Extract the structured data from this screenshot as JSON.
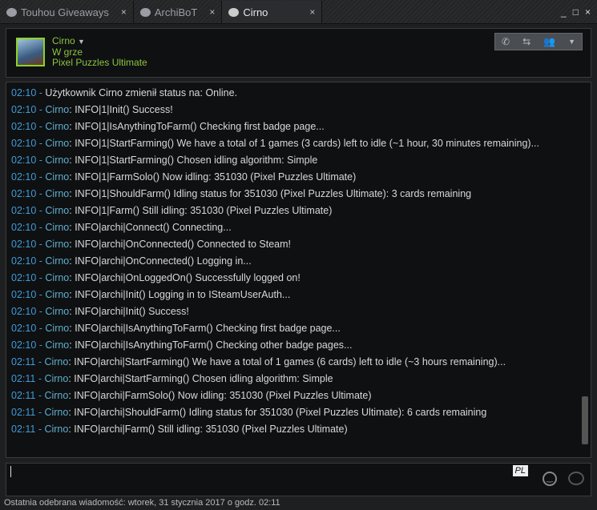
{
  "tabs": [
    {
      "label": "Touhou Giveaways",
      "close": "×"
    },
    {
      "label": "ArchiBoT",
      "close": "×"
    },
    {
      "label": "Cirno",
      "close": "×"
    }
  ],
  "window_controls": {
    "minimize": "_",
    "maximize": "□",
    "close": "×"
  },
  "header": {
    "name": "Cirno",
    "status": "W grze",
    "game": "Pixel Puzzles Ultimate"
  },
  "messages": [
    {
      "time": "02:10",
      "sep": " - ",
      "name": "",
      "text": "Użytkownik Cirno zmienił status na: Online."
    },
    {
      "time": "02:10",
      "sep": " - ",
      "name": "Cirno",
      "text": ": INFO|1|Init() Success!"
    },
    {
      "time": "02:10",
      "sep": " - ",
      "name": "Cirno",
      "text": ": INFO|1|IsAnythingToFarm() Checking first badge page..."
    },
    {
      "time": "02:10",
      "sep": " - ",
      "name": "Cirno",
      "text": ": INFO|1|StartFarming() We have a total of 1 games (3 cards) left to idle (~1 hour, 30 minutes remaining)..."
    },
    {
      "time": "02:10",
      "sep": " - ",
      "name": "Cirno",
      "text": ": INFO|1|StartFarming() Chosen idling algorithm: Simple"
    },
    {
      "time": "02:10",
      "sep": " - ",
      "name": "Cirno",
      "text": ": INFO|1|FarmSolo() Now idling: 351030 (Pixel Puzzles Ultimate)"
    },
    {
      "time": "02:10",
      "sep": " - ",
      "name": "Cirno",
      "text": ": INFO|1|ShouldFarm() Idling status for 351030 (Pixel Puzzles Ultimate): 3 cards remaining"
    },
    {
      "time": "02:10",
      "sep": " - ",
      "name": "Cirno",
      "text": ": INFO|1|Farm() Still idling: 351030 (Pixel Puzzles Ultimate)"
    },
    {
      "time": "02:10",
      "sep": " - ",
      "name": "Cirno",
      "text": ": INFO|archi|Connect() Connecting..."
    },
    {
      "time": "02:10",
      "sep": " - ",
      "name": "Cirno",
      "text": ": INFO|archi|OnConnected() Connected to Steam!"
    },
    {
      "time": "02:10",
      "sep": " - ",
      "name": "Cirno",
      "text": ": INFO|archi|OnConnected() Logging in..."
    },
    {
      "time": "02:10",
      "sep": " - ",
      "name": "Cirno",
      "text": ": INFO|archi|OnLoggedOn() Successfully logged on!"
    },
    {
      "time": "02:10",
      "sep": " - ",
      "name": "Cirno",
      "text": ": INFO|archi|Init() Logging in to ISteamUserAuth..."
    },
    {
      "time": "02:10",
      "sep": " - ",
      "name": "Cirno",
      "text": ": INFO|archi|Init() Success!"
    },
    {
      "time": "02:10",
      "sep": " - ",
      "name": "Cirno",
      "text": ": INFO|archi|IsAnythingToFarm() Checking first badge page..."
    },
    {
      "time": "02:10",
      "sep": " - ",
      "name": "Cirno",
      "text": ": INFO|archi|IsAnythingToFarm() Checking other badge pages..."
    },
    {
      "time": "02:11",
      "sep": " - ",
      "name": "Cirno",
      "text": ": INFO|archi|StartFarming() We have a total of 1 games (6 cards) left to idle (~3 hours remaining)..."
    },
    {
      "time": "02:11",
      "sep": " - ",
      "name": "Cirno",
      "text": ": INFO|archi|StartFarming() Chosen idling algorithm: Simple"
    },
    {
      "time": "02:11",
      "sep": " - ",
      "name": "Cirno",
      "text": ": INFO|archi|FarmSolo() Now idling: 351030 (Pixel Puzzles Ultimate)"
    },
    {
      "time": "02:11",
      "sep": " - ",
      "name": "Cirno",
      "text": ": INFO|archi|ShouldFarm() Idling status for 351030 (Pixel Puzzles Ultimate): 6 cards remaining"
    },
    {
      "time": "02:11",
      "sep": " - ",
      "name": "Cirno",
      "text": ": INFO|archi|Farm() Still idling: 351030 (Pixel Puzzles Ultimate)"
    }
  ],
  "input": {
    "language": "PL",
    "value": ""
  },
  "status_bar": "Ostatnia odebrana wiadomość: wtorek, 31 stycznia 2017 o godz. 02:11"
}
